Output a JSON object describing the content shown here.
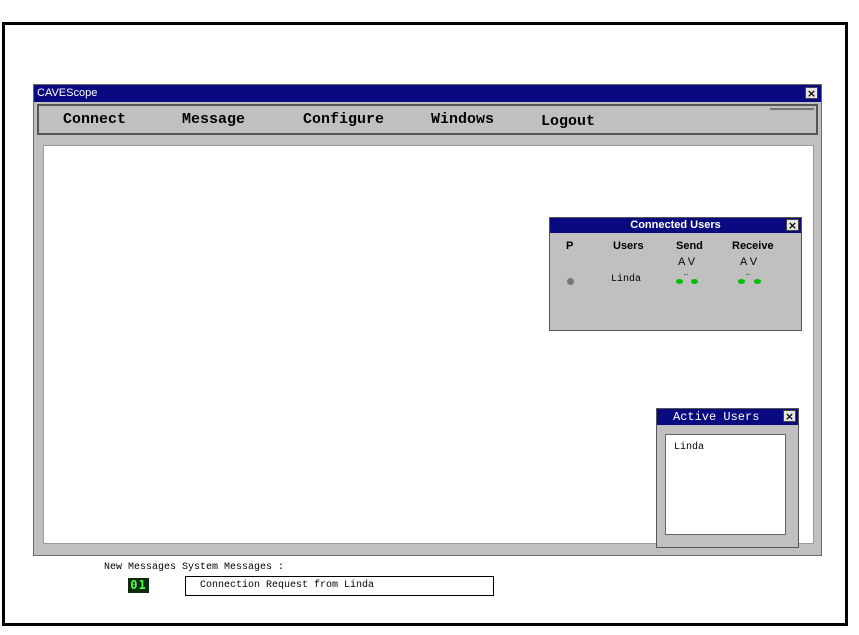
{
  "app": {
    "title": "CAVEScope"
  },
  "menu": [
    {
      "label": "Connect"
    },
    {
      "label": "Message"
    },
    {
      "label": "Configure"
    },
    {
      "label": "Windows"
    },
    {
      "label": "Logout"
    }
  ],
  "connected_users": {
    "title": "Connected Users",
    "columns": {
      "p": "P",
      "users": "Users",
      "send": "Send",
      "receive": "Receive"
    },
    "av_send": "A V",
    "av_receive": "A V",
    "rows": [
      {
        "name": "Linda"
      }
    ]
  },
  "active_users": {
    "title": "Active Users",
    "items": [
      "Linda"
    ]
  },
  "status": {
    "new_messages_label": "New Messages",
    "system_messages_label": "System Messages :",
    "new_messages_count": "01",
    "system_message": "Connection Request from Linda"
  },
  "colors": {
    "titlebar": "#0a0a80",
    "window_bg": "#c0c0c0",
    "led_green": "#00c000",
    "counter_bg": "#0c2a0c",
    "counter_fg": "#4cff4c"
  },
  "icons": {
    "close": "close-icon"
  }
}
